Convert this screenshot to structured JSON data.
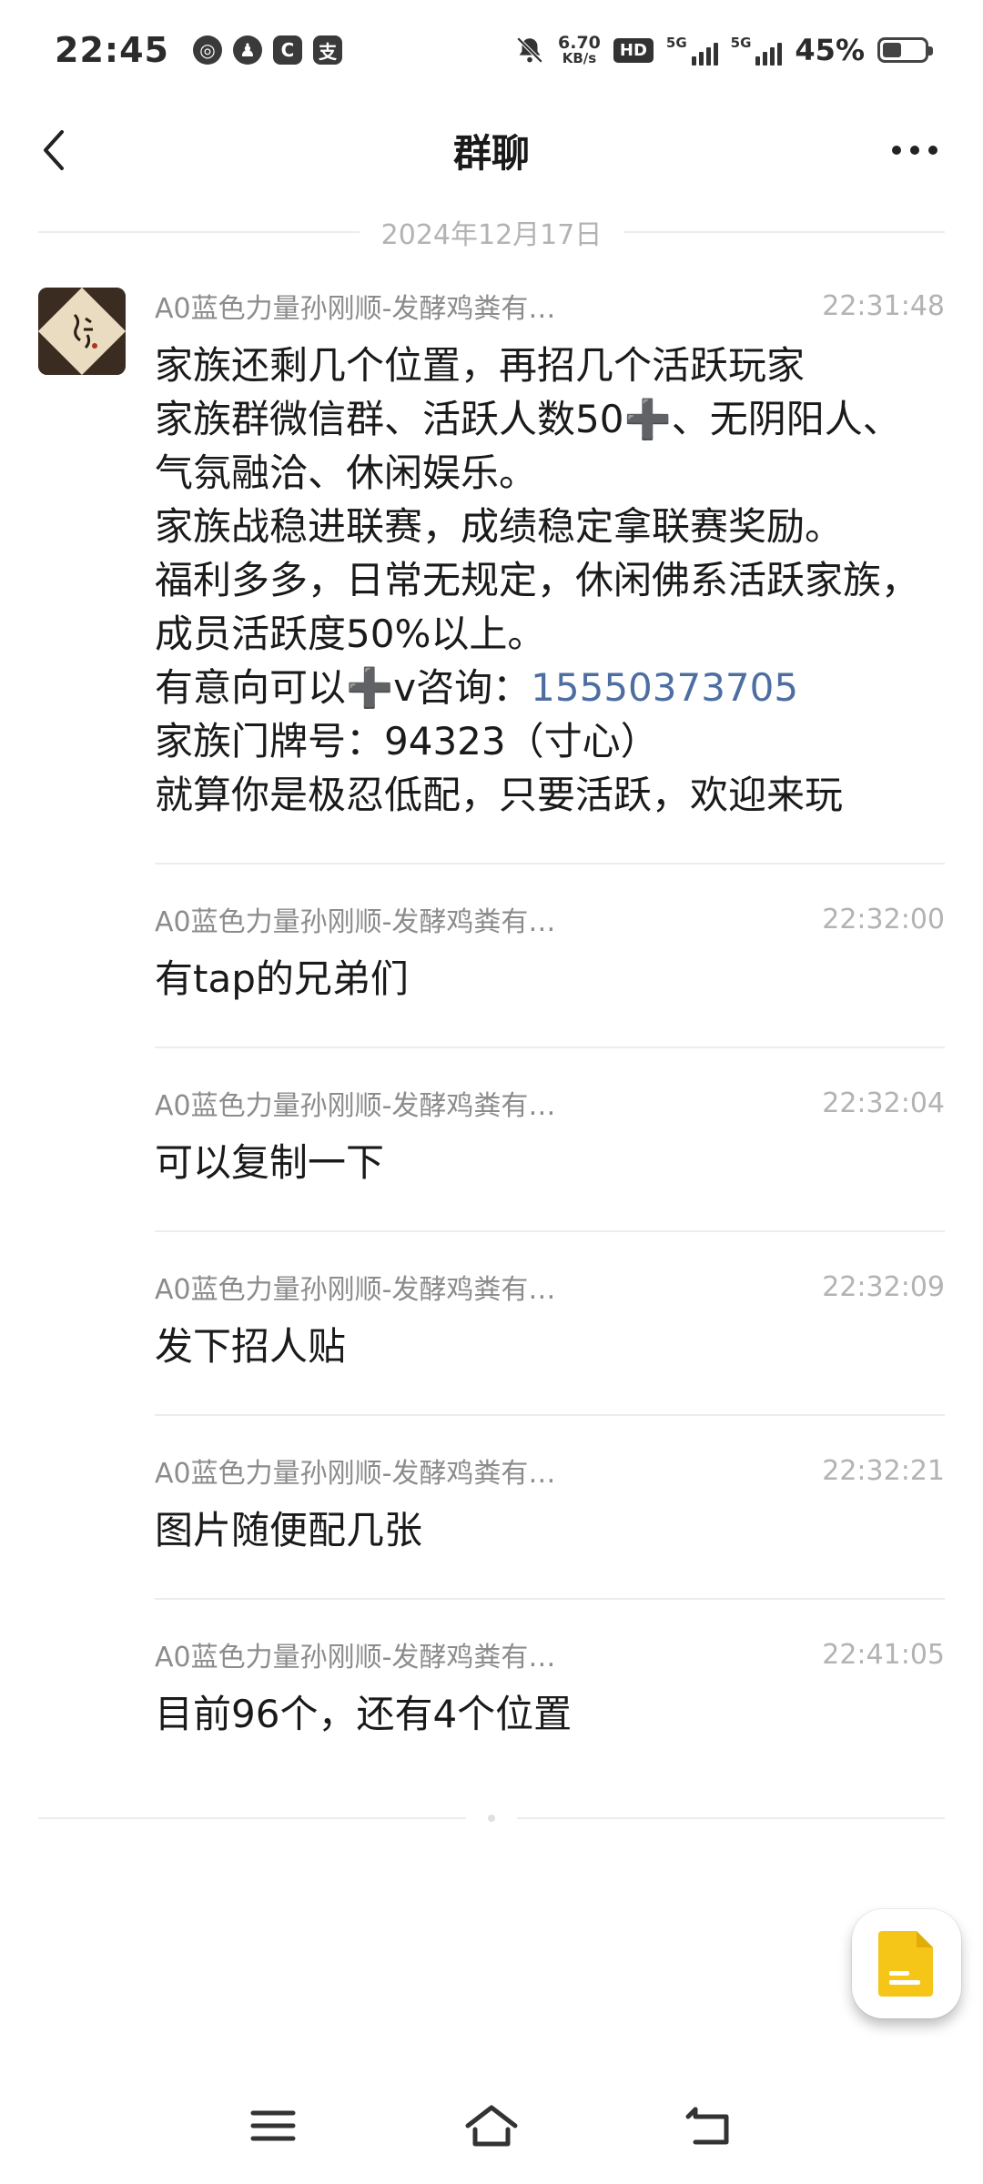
{
  "status_bar": {
    "time": "22:45",
    "net_speed_value": "6.70",
    "net_speed_unit": "KB/s",
    "hd_label": "HD",
    "network_label": "5G",
    "battery_percent": "45%",
    "battery_level": 0.45
  },
  "nav": {
    "title": "群聊"
  },
  "date_divider": "2024年12月17日",
  "messages": [
    {
      "sender": "A0蓝色力量孙刚顺-发酵鸡粪有…",
      "time": "22:31:48",
      "lines": [
        "家族还剩几个位置，再招几个活跃玩家",
        "家族群微信群、活跃人数50➕、无阴阳人、",
        "气氛融洽、休闲娱乐。",
        "家族战稳进联赛，成绩稳定拿联赛奖励。",
        "福利多多，日常无规定，休闲佛系活跃家族，",
        "成员活跃度50%以上。"
      ],
      "contact_prefix": "有意向可以➕v咨询：",
      "phone": "15550373705",
      "lines_after": [
        "家族门牌号：94323（寸心）",
        "就算你是极忍低配，只要活跃，欢迎来玩"
      ]
    },
    {
      "sender": "A0蓝色力量孙刚顺-发酵鸡粪有…",
      "time": "22:32:00",
      "text": "有tap的兄弟们"
    },
    {
      "sender": "A0蓝色力量孙刚顺-发酵鸡粪有…",
      "time": "22:32:04",
      "text": "可以复制一下"
    },
    {
      "sender": "A0蓝色力量孙刚顺-发酵鸡粪有…",
      "time": "22:32:09",
      "text": "发下招人贴"
    },
    {
      "sender": "A0蓝色力量孙刚顺-发酵鸡粪有…",
      "time": "22:32:21",
      "text": "图片随便配几张"
    },
    {
      "sender": "A0蓝色力量孙刚顺-发酵鸡粪有…",
      "time": "22:41:05",
      "text": "目前96个，还有4个位置"
    }
  ],
  "colors": {
    "link": "#4d6ea1",
    "meta_text": "#8c8c8c",
    "fab_icon": "#f5c518"
  },
  "icons": {
    "back": "chevron-left-icon",
    "more": "more-dots-icon",
    "fab": "document-icon",
    "menu": "menu-icon",
    "home": "home-icon",
    "return": "back-gesture-icon"
  }
}
